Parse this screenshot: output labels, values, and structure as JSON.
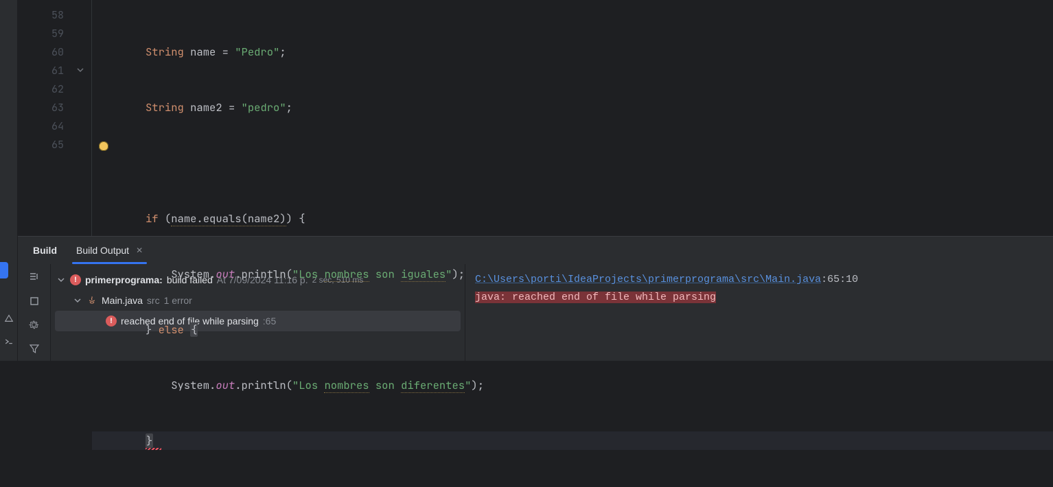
{
  "editor": {
    "lines": [
      {
        "n": 58
      },
      {
        "n": 59
      },
      {
        "n": 60
      },
      {
        "n": 61,
        "foldable": true
      },
      {
        "n": 62
      },
      {
        "n": 63
      },
      {
        "n": 64
      },
      {
        "n": 65,
        "current": true,
        "bulb": true
      }
    ],
    "code": {
      "l58": {
        "type": "String",
        "var": "name",
        "eq": " = ",
        "str": "\"Pedro\"",
        "semi": ";"
      },
      "l59": {
        "type": "String",
        "var": "name2",
        "eq": " = ",
        "str": "\"pedro\"",
        "semi": ";"
      },
      "l61": {
        "kw_if": "if",
        "open": " (",
        "cond": "name.equals(name2)",
        "close": ") {",
        "brace": "{"
      },
      "l62": {
        "sys": "System.",
        "out": "out",
        "call": ".println(",
        "q1": "\"Los ",
        "w1": "nombres",
        "mid": " son ",
        "w2": "iguales",
        "q2": "\"",
        "end": ");"
      },
      "l63": {
        "closebrace": "}",
        "kw_else": " else ",
        "brace": "{"
      },
      "l64": {
        "sys": "System.",
        "out": "out",
        "call": ".println(",
        "q1": "\"Los ",
        "w1": "nombres",
        "mid": " son ",
        "w2": "diferentes",
        "q2": "\"",
        "end": ");"
      },
      "l65": {
        "brace": "}"
      }
    }
  },
  "panel": {
    "tab_main": "Build",
    "tab_active": "Build Output",
    "tree": {
      "root_name": "primerprograma:",
      "root_status": "build failed",
      "root_time": "At 7/09/2024 11:16 p.",
      "root_dur": "2 sec, 510 ms",
      "file_name": "Main.java",
      "file_path": "src",
      "file_errs": "1 error",
      "err_msg": "reached end of file while parsing",
      "err_line": ":65"
    },
    "output": {
      "path": "C:\\Users\\porti\\IdeaProjects\\primerprograma\\src\\Main.java",
      "loc": ":65:10",
      "msg": "java: reached end of file while parsing"
    }
  }
}
